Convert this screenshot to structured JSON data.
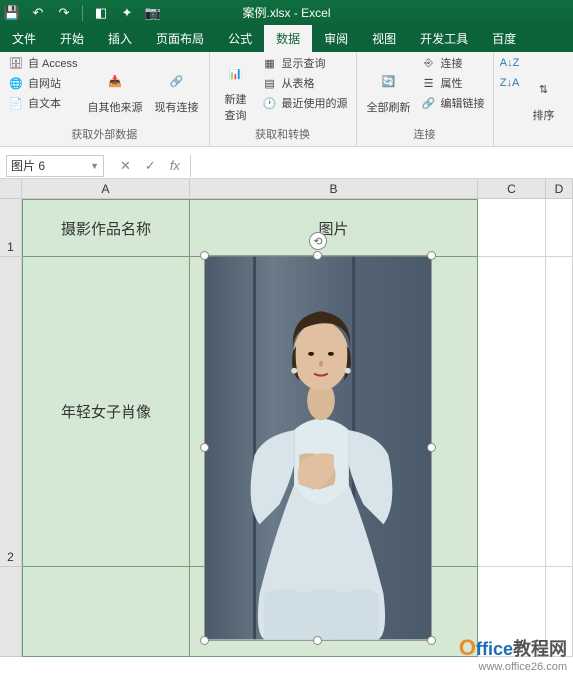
{
  "app": {
    "title": "案例.xlsx - Excel"
  },
  "qat": {
    "icons": [
      "save",
      "undo",
      "redo",
      "touch",
      "new",
      "camera"
    ]
  },
  "tabs": {
    "items": [
      {
        "label": "文件"
      },
      {
        "label": "开始"
      },
      {
        "label": "插入"
      },
      {
        "label": "页面布局"
      },
      {
        "label": "公式"
      },
      {
        "label": "数据"
      },
      {
        "label": "审阅"
      },
      {
        "label": "视图"
      },
      {
        "label": "开发工具"
      },
      {
        "label": "百度"
      }
    ],
    "active_index": 5
  },
  "ribbon": {
    "group1": {
      "label": "获取外部数据",
      "from_access": "自 Access",
      "from_web": "自网站",
      "from_text": "自文本",
      "from_other": "自其他来源",
      "existing_conn": "现有连接"
    },
    "group2": {
      "label": "获取和转换",
      "new_query": "新建\n查询",
      "show_query": "显示查询",
      "from_table": "从表格",
      "recent": "最近使用的源"
    },
    "group3": {
      "label": "连接",
      "refresh_all": "全部刷新",
      "connections": "连接",
      "properties": "属性",
      "edit_links": "编辑链接"
    },
    "group4": {
      "sort": "排序"
    }
  },
  "namebox": {
    "value": "图片 6"
  },
  "columns": {
    "A": "A",
    "B": "B",
    "C": "C",
    "D": "D"
  },
  "rows": {
    "r1": "1",
    "r2": "2"
  },
  "cells": {
    "A1": "摄影作品名称",
    "B1": "图片",
    "A2": "年轻女子肖像"
  },
  "watermark": {
    "brand_o": "O",
    "brand_rest": "ffice",
    "brand_cn": "教程网",
    "url": "www.office26.com"
  }
}
